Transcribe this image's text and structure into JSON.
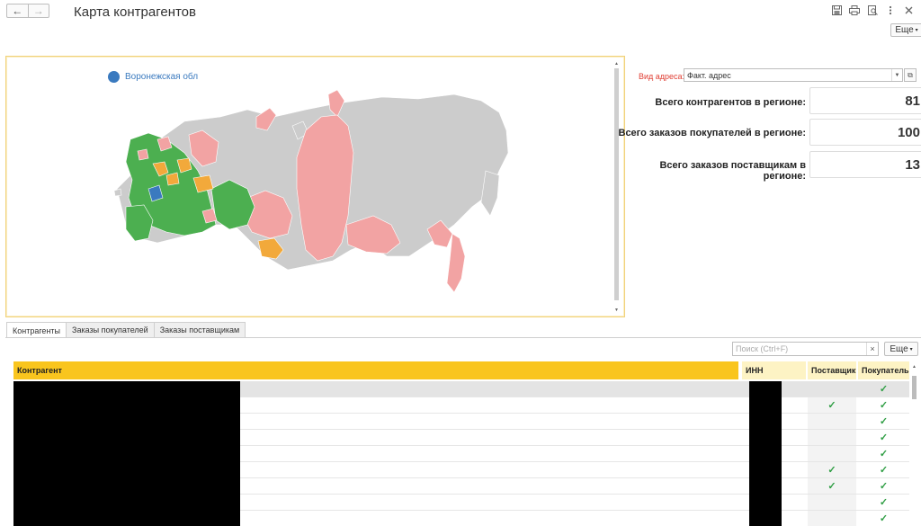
{
  "header": {
    "title": "Карта контрагентов",
    "back_label": "←",
    "forward_label": "→",
    "more_label": "Еще"
  },
  "map": {
    "legend_label": "Воронежская обл",
    "colors": {
      "green": "#4caf50",
      "pink": "#f2a3a3",
      "orange": "#f2a93b",
      "gray": "#cccccc",
      "selected": "#3a7abf"
    }
  },
  "address": {
    "label": "Вид адреса:",
    "value": "Факт. адрес"
  },
  "stats": [
    {
      "label": "Всего контрагентов в регионе:",
      "value": "81"
    },
    {
      "label": "Всего заказов покупателей в регионе:",
      "value": "100"
    },
    {
      "label": "Всего заказов поставщикам в регионе:",
      "value": "13"
    }
  ],
  "tabs": [
    {
      "label": "Контрагенты",
      "active": true
    },
    {
      "label": "Заказы покупателей",
      "active": false
    },
    {
      "label": "Заказы поставщикам",
      "active": false
    }
  ],
  "table": {
    "search_placeholder": "Поиск (Ctrl+F)",
    "more_label": "Еще",
    "columns": [
      "Контрагент",
      "ИНН",
      "Поставщик",
      "Покупатель"
    ],
    "check_glyph": "✓",
    "rows": [
      {
        "supplier": false,
        "buyer": true
      },
      {
        "supplier": true,
        "buyer": true
      },
      {
        "supplier": false,
        "buyer": true
      },
      {
        "supplier": false,
        "buyer": true
      },
      {
        "supplier": false,
        "buyer": true
      },
      {
        "supplier": true,
        "buyer": true
      },
      {
        "supplier": true,
        "buyer": true
      },
      {
        "supplier": false,
        "buyer": true
      },
      {
        "supplier": false,
        "buyer": true
      },
      {
        "supplier": true,
        "buyer": true
      }
    ]
  }
}
